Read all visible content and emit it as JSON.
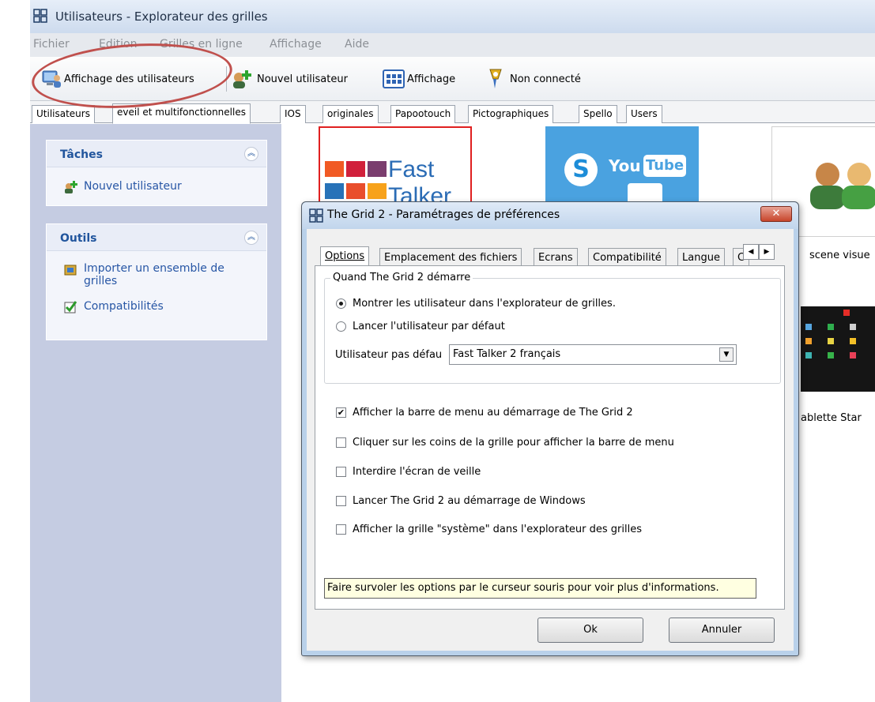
{
  "window": {
    "title": "Utilisateurs - Explorateur des grilles"
  },
  "menu": [
    "Fichier",
    "Edition",
    "Grilles en ligne",
    "Affichage",
    "Aide"
  ],
  "toolbar": {
    "users_view": "Affichage des utilisateurs",
    "new_user": "Nouvel utilisateur",
    "view": "Affichage",
    "status": "Non connecté"
  },
  "grid_tabs": [
    "Utilisateurs",
    "eveil et multifonctionnelles",
    "IOS",
    "originales",
    "Papootouch",
    "Pictographiques",
    "Spello",
    "Users"
  ],
  "left": {
    "tasks": {
      "title": "Tâches",
      "items": [
        "Nouvel utilisateur"
      ]
    },
    "tools": {
      "title": "Outils",
      "items": [
        "Importer un ensemble de grilles",
        "Compatibilités"
      ]
    }
  },
  "thumbnails": {
    "fast_talker": {
      "line1": "Fast",
      "line2": "Talker"
    },
    "social": {
      "skype": "S",
      "youtube_you": "You",
      "youtube_tube": "Tube"
    },
    "labels": {
      "scene": "scene visue",
      "tablette": "ablette Star"
    }
  },
  "dialog": {
    "title": "The Grid 2 - Paramétrages de préférences",
    "close": "✕",
    "tabs": [
      "Options",
      "Emplacement des fichiers",
      "Ecrans",
      "Compatibilité",
      "Langue",
      "C"
    ],
    "group_title": "Quand The Grid 2 démarre",
    "radios": [
      {
        "label": "Montrer les utilisateur dans l'explorateur de grilles.",
        "checked": true
      },
      {
        "label": "Lancer l'utilisateur par défaut",
        "checked": false
      }
    ],
    "default_user_label": "Utilisateur pas défau",
    "default_user_value": "Fast Talker 2 français",
    "checkboxes": [
      {
        "label": "Afficher la barre de menu au démarrage de The Grid 2",
        "checked": true
      },
      {
        "label": "Cliquer sur les coins de la grille pour afficher la barre de menu",
        "checked": false
      },
      {
        "label": "Interdire l'écran de veille",
        "checked": false
      },
      {
        "label": "Lancer The Grid 2 au démarrage de Windows",
        "checked": false
      },
      {
        "label": "Afficher la grille \"système\" dans l'explorateur des grilles",
        "checked": false
      }
    ],
    "hint": "Faire survoler les options par le curseur souris pour voir plus d'informations.",
    "ok": "Ok",
    "cancel": "Annuler"
  },
  "colors": {
    "accent": "#21559d",
    "annotation": "#c0504d",
    "pane": "#c5cce2"
  }
}
